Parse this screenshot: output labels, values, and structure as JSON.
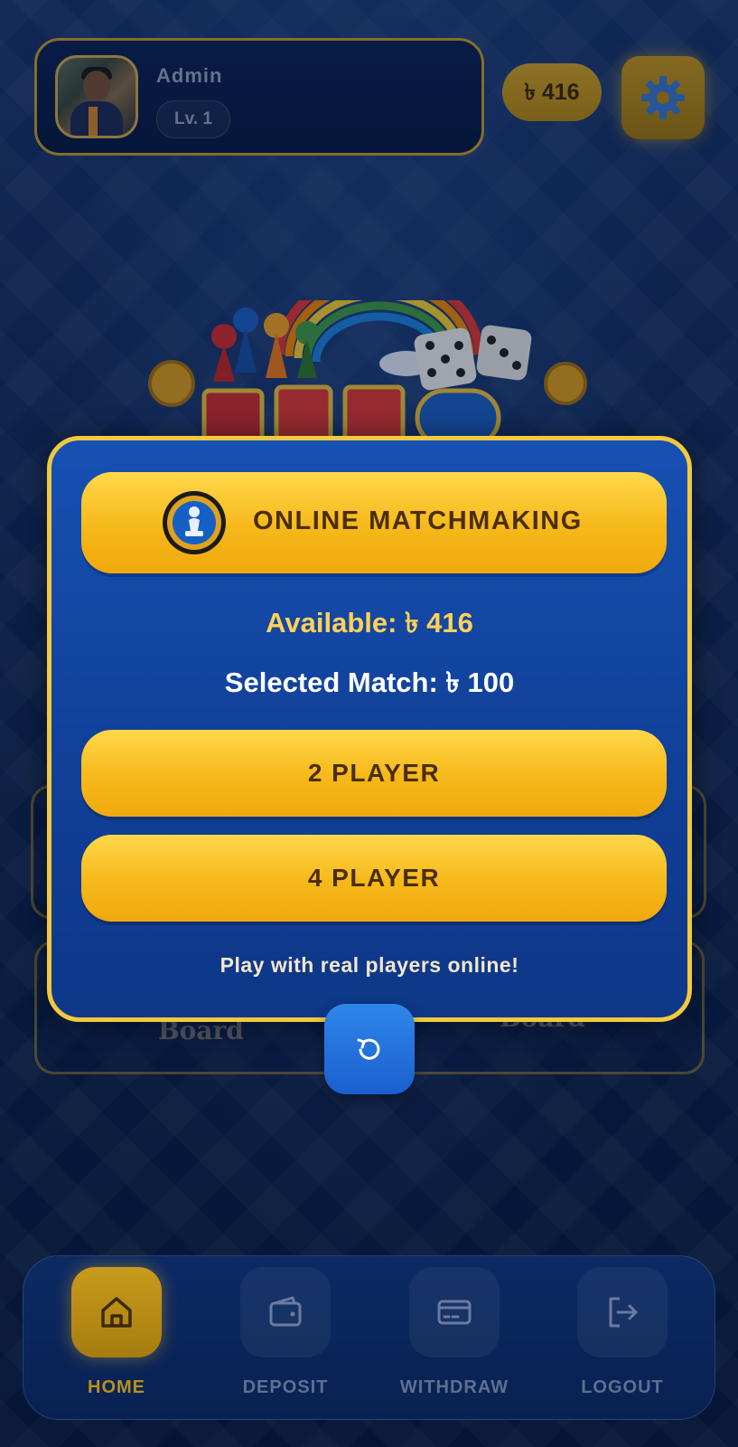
{
  "header": {
    "username": "Admin",
    "level": "Lv. 1",
    "balance": "৳ 416"
  },
  "background_cards": {
    "left_label": "Board",
    "right_label": "Board"
  },
  "modal": {
    "matchmaking_label": "ONLINE MATCHMAKING",
    "available": "Available: ৳ 416",
    "selected_match": "Selected Match: ৳ 100",
    "two_player_label": "2 PLAYER",
    "four_player_label": "4 PLAYER",
    "hint": "Play with real players online!"
  },
  "nav": {
    "items": [
      {
        "label": "HOME",
        "icon": "home-icon",
        "active": true
      },
      {
        "label": "DEPOSIT",
        "icon": "wallet-icon",
        "active": false
      },
      {
        "label": "WITHDRAW",
        "icon": "card-icon",
        "active": false
      },
      {
        "label": "LOGOUT",
        "icon": "logout-icon",
        "active": false
      }
    ]
  },
  "colors": {
    "gold": "#f6b81a",
    "modal_blue": "#1750b3",
    "modal_border": "#f2c93e",
    "available_text": "#ffd257",
    "refresh_blue": "#2f86ea"
  }
}
